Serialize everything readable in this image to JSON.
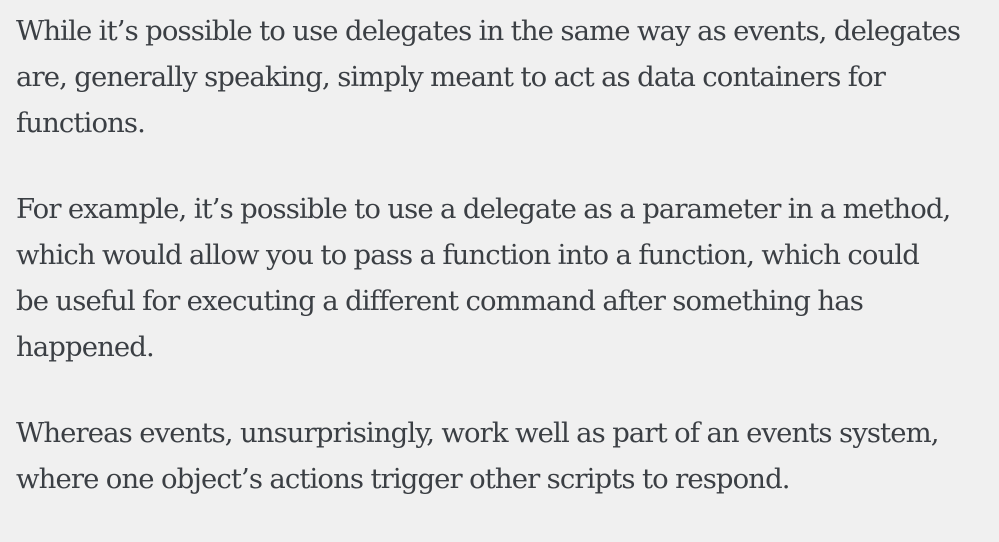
{
  "article": {
    "paragraphs": [
      {
        "lines": [
          "While it’s possible to use delegates in the same way as events, delegates",
          "are, generally speaking, simply meant to act as data containers for",
          "functions."
        ]
      },
      {
        "lines": [
          "For example, it’s possible to use a delegate as a parameter in a method,",
          "which would allow you to pass a function into a function, which could",
          "be useful for executing a different command after something has",
          "happened."
        ]
      },
      {
        "lines": [
          "Whereas events, unsurprisingly, work well as part of an events system,",
          "where one object’s actions trigger other scripts to respond."
        ]
      }
    ]
  }
}
